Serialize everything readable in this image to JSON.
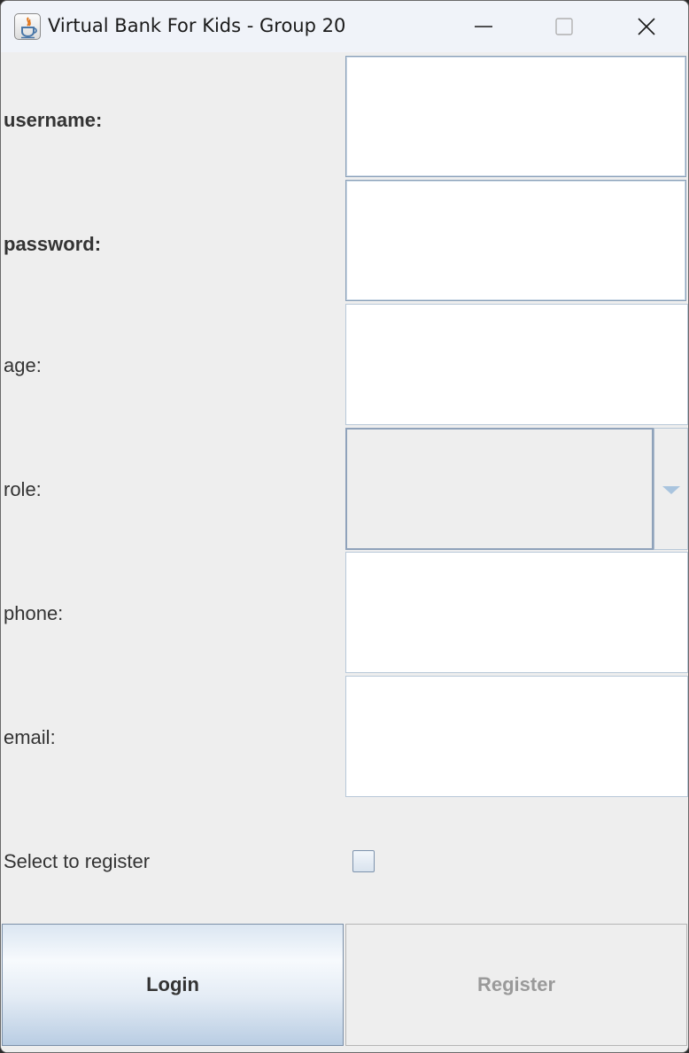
{
  "window": {
    "title": "Virtual Bank For Kids - Group 20",
    "icon": "java-app-icon",
    "controls": [
      "minimize-icon",
      "maximize-icon",
      "close-icon"
    ]
  },
  "form": {
    "username_label": "username:",
    "username_value": "",
    "password_label": "password:",
    "password_value": "",
    "age_label": "age:",
    "age_value": "",
    "role_label": "role:",
    "role_value": "",
    "phone_label": "phone:",
    "phone_value": "",
    "email_label": "email:",
    "email_value": "",
    "register_toggle_label": "Select to register",
    "register_toggle_checked": false
  },
  "buttons": {
    "login_label": "Login",
    "register_label": "Register",
    "register_enabled": false
  },
  "colors": {
    "background": "#eeeeee",
    "field_border": "#b8c8d8",
    "disabled_text": "#9a9a9a",
    "login_gradient_bottom": "#b9cde3"
  }
}
